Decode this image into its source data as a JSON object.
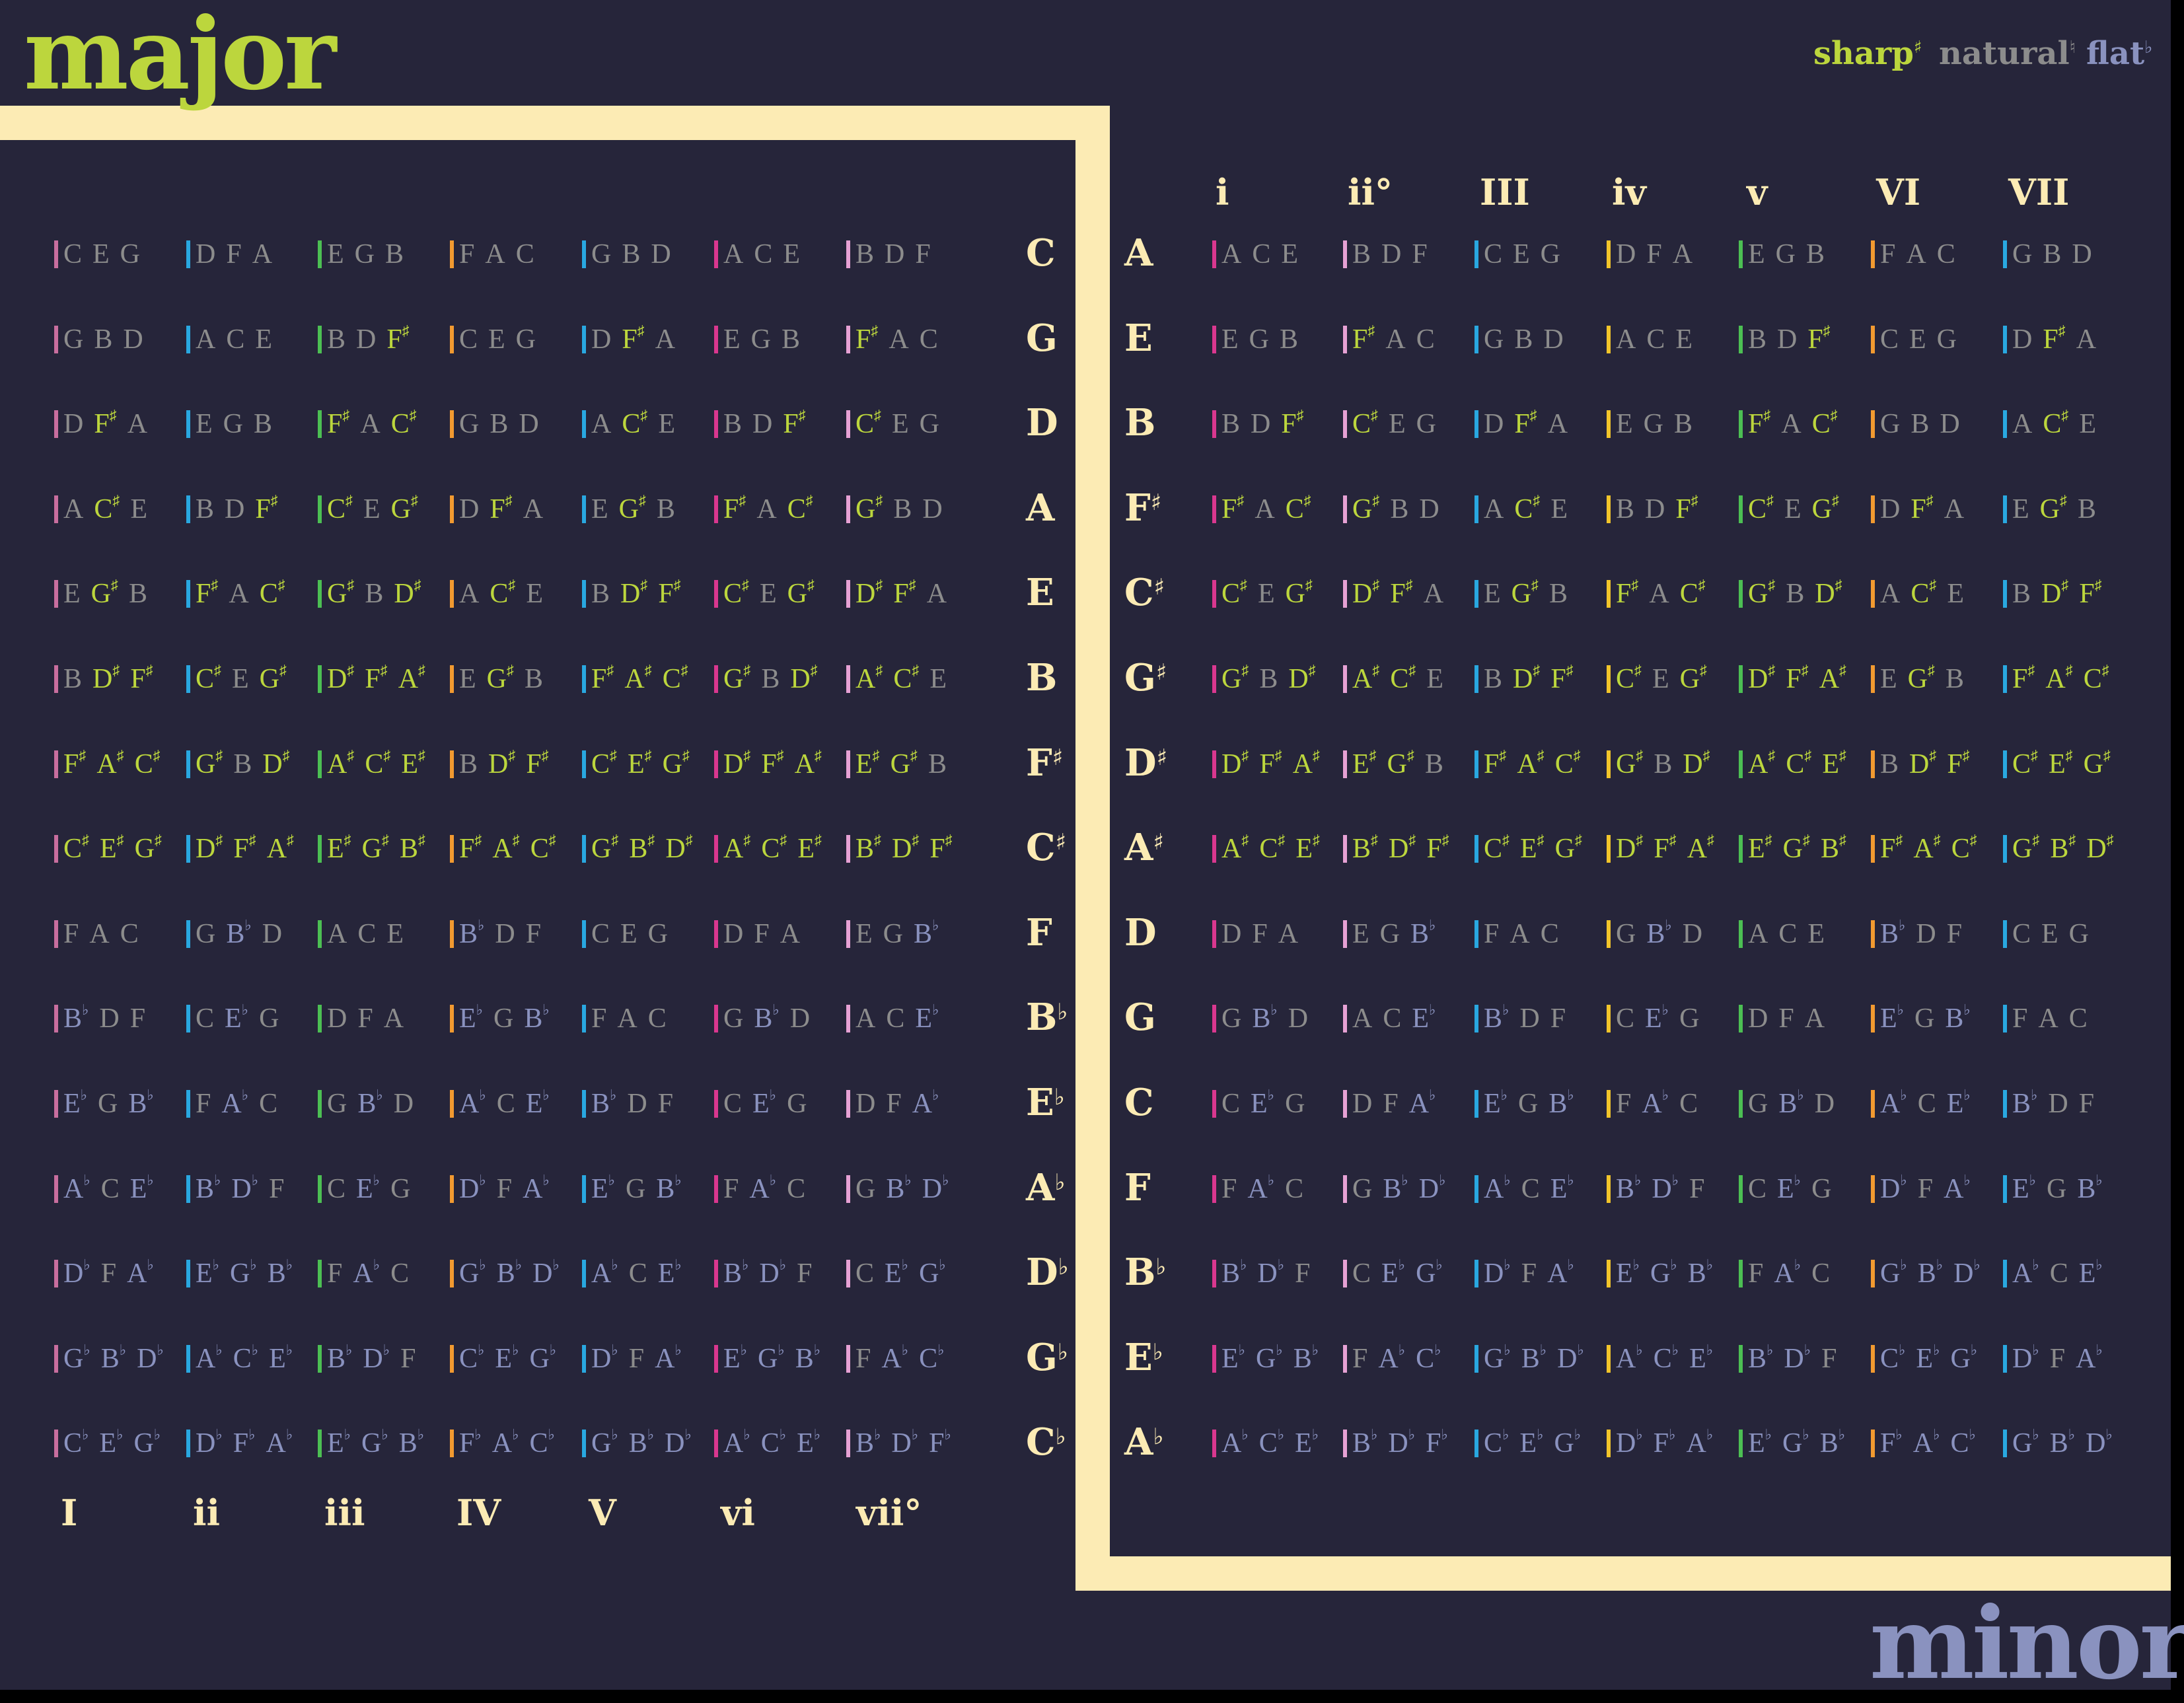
{
  "colors": {
    "background": "#26253a",
    "frame": "#fcebb4",
    "major_title": "#bcd63d",
    "minor_title": "#8a92bf",
    "sharp": "#bcd63d",
    "natural": "#8c8c8c",
    "flat": "#8a92bf",
    "key_label": "#fcebb4",
    "numeral": "#fcebb4"
  },
  "accidental_glyphs": {
    "#": "♯",
    "b": "♭",
    "n": "♮"
  },
  "titles": {
    "major": "major",
    "minor": "minor"
  },
  "legend": [
    {
      "label": "sharp",
      "symbol": "♯",
      "color": "#bcd63d"
    },
    {
      "label": "natural",
      "symbol": "♮",
      "color": "#8c8c8c"
    },
    {
      "label": "flat",
      "symbol": "♭",
      "color": "#8a92bf"
    }
  ],
  "numeral_bar_colors": {
    "I": "#c86e9e",
    "ii": "#29a8e0",
    "iii": "#4cbf53",
    "IV": "#f29a30",
    "V": "#29a8e0",
    "vi": "#d9378f",
    "vii°": "#e6a1d4",
    "i": "#d9378f",
    "ii°": "#e6a1d4",
    "III": "#29a8e0",
    "iv": "#f2c52a",
    "v": "#4cbf53",
    "VI": "#f29a30",
    "VII": "#29a8e0"
  },
  "major": {
    "numerals": [
      "I",
      "ii",
      "iii",
      "IV",
      "V",
      "vi",
      "vii°"
    ],
    "keys": [
      "C",
      "G",
      "D",
      "A",
      "E",
      "B",
      "F#",
      "C#",
      "F",
      "Bb",
      "Eb",
      "Ab",
      "Db",
      "Gb",
      "Cb"
    ],
    "rows": [
      [
        [
          "C",
          "E",
          "G"
        ],
        [
          "D",
          "F",
          "A"
        ],
        [
          "E",
          "G",
          "B"
        ],
        [
          "F",
          "A",
          "C"
        ],
        [
          "G",
          "B",
          "D"
        ],
        [
          "A",
          "C",
          "E"
        ],
        [
          "B",
          "D",
          "F"
        ]
      ],
      [
        [
          "G",
          "B",
          "D"
        ],
        [
          "A",
          "C",
          "E"
        ],
        [
          "B",
          "D",
          "F#"
        ],
        [
          "C",
          "E",
          "G"
        ],
        [
          "D",
          "F#",
          "A"
        ],
        [
          "E",
          "G",
          "B"
        ],
        [
          "F#",
          "A",
          "C"
        ]
      ],
      [
        [
          "D",
          "F#",
          "A"
        ],
        [
          "E",
          "G",
          "B"
        ],
        [
          "F#",
          "A",
          "C#"
        ],
        [
          "G",
          "B",
          "D"
        ],
        [
          "A",
          "C#",
          "E"
        ],
        [
          "B",
          "D",
          "F#"
        ],
        [
          "C#",
          "E",
          "G"
        ]
      ],
      [
        [
          "A",
          "C#",
          "E"
        ],
        [
          "B",
          "D",
          "F#"
        ],
        [
          "C#",
          "E",
          "G#"
        ],
        [
          "D",
          "F#",
          "A"
        ],
        [
          "E",
          "G#",
          "B"
        ],
        [
          "F#",
          "A",
          "C#"
        ],
        [
          "G#",
          "B",
          "D"
        ]
      ],
      [
        [
          "E",
          "G#",
          "B"
        ],
        [
          "F#",
          "A",
          "C#"
        ],
        [
          "G#",
          "B",
          "D#"
        ],
        [
          "A",
          "C#",
          "E"
        ],
        [
          "B",
          "D#",
          "F#"
        ],
        [
          "C#",
          "E",
          "G#"
        ],
        [
          "D#",
          "F#",
          "A"
        ]
      ],
      [
        [
          "B",
          "D#",
          "F#"
        ],
        [
          "C#",
          "E",
          "G#"
        ],
        [
          "D#",
          "F#",
          "A#"
        ],
        [
          "E",
          "G#",
          "B"
        ],
        [
          "F#",
          "A#",
          "C#"
        ],
        [
          "G#",
          "B",
          "D#"
        ],
        [
          "A#",
          "C#",
          "E"
        ]
      ],
      [
        [
          "F#",
          "A#",
          "C#"
        ],
        [
          "G#",
          "B",
          "D#"
        ],
        [
          "A#",
          "C#",
          "E#"
        ],
        [
          "B",
          "D#",
          "F#"
        ],
        [
          "C#",
          "E#",
          "G#"
        ],
        [
          "D#",
          "F#",
          "A#"
        ],
        [
          "E#",
          "G#",
          "B"
        ]
      ],
      [
        [
          "C#",
          "E#",
          "G#"
        ],
        [
          "D#",
          "F#",
          "A#"
        ],
        [
          "E#",
          "G#",
          "B#"
        ],
        [
          "F#",
          "A#",
          "C#"
        ],
        [
          "G#",
          "B#",
          "D#"
        ],
        [
          "A#",
          "C#",
          "E#"
        ],
        [
          "B#",
          "D#",
          "F#"
        ]
      ],
      [
        [
          "F",
          "A",
          "C"
        ],
        [
          "G",
          "Bb",
          "D"
        ],
        [
          "A",
          "C",
          "E"
        ],
        [
          "Bb",
          "D",
          "F"
        ],
        [
          "C",
          "E",
          "G"
        ],
        [
          "D",
          "F",
          "A"
        ],
        [
          "E",
          "G",
          "Bb"
        ]
      ],
      [
        [
          "Bb",
          "D",
          "F"
        ],
        [
          "C",
          "Eb",
          "G"
        ],
        [
          "D",
          "F",
          "A"
        ],
        [
          "Eb",
          "G",
          "Bb"
        ],
        [
          "F",
          "A",
          "C"
        ],
        [
          "G",
          "Bb",
          "D"
        ],
        [
          "A",
          "C",
          "Eb"
        ]
      ],
      [
        [
          "Eb",
          "G",
          "Bb"
        ],
        [
          "F",
          "Ab",
          "C"
        ],
        [
          "G",
          "Bb",
          "D"
        ],
        [
          "Ab",
          "C",
          "Eb"
        ],
        [
          "Bb",
          "D",
          "F"
        ],
        [
          "C",
          "Eb",
          "G"
        ],
        [
          "D",
          "F",
          "Ab"
        ]
      ],
      [
        [
          "Ab",
          "C",
          "Eb"
        ],
        [
          "Bb",
          "Db",
          "F"
        ],
        [
          "C",
          "Eb",
          "G"
        ],
        [
          "Db",
          "F",
          "Ab"
        ],
        [
          "Eb",
          "G",
          "Bb"
        ],
        [
          "F",
          "Ab",
          "C"
        ],
        [
          "G",
          "Bb",
          "Db"
        ]
      ],
      [
        [
          "Db",
          "F",
          "Ab"
        ],
        [
          "Eb",
          "Gb",
          "Bb"
        ],
        [
          "F",
          "Ab",
          "C"
        ],
        [
          "Gb",
          "Bb",
          "Db"
        ],
        [
          "Ab",
          "C",
          "Eb"
        ],
        [
          "Bb",
          "Db",
          "F"
        ],
        [
          "C",
          "Eb",
          "Gb"
        ]
      ],
      [
        [
          "Gb",
          "Bb",
          "Db"
        ],
        [
          "Ab",
          "Cb",
          "Eb"
        ],
        [
          "Bb",
          "Db",
          "F"
        ],
        [
          "Cb",
          "Eb",
          "Gb"
        ],
        [
          "Db",
          "F",
          "Ab"
        ],
        [
          "Eb",
          "Gb",
          "Bb"
        ],
        [
          "F",
          "Ab",
          "Cb"
        ]
      ],
      [
        [
          "Cb",
          "Eb",
          "Gb"
        ],
        [
          "Db",
          "Fb",
          "Ab"
        ],
        [
          "Eb",
          "Gb",
          "Bb"
        ],
        [
          "Fb",
          "Ab",
          "Cb"
        ],
        [
          "Gb",
          "Bb",
          "Db"
        ],
        [
          "Ab",
          "Cb",
          "Eb"
        ],
        [
          "Bb",
          "Db",
          "Fb"
        ]
      ]
    ]
  },
  "minor": {
    "numerals": [
      "i",
      "ii°",
      "III",
      "iv",
      "v",
      "VI",
      "VII"
    ],
    "keys": [
      "A",
      "E",
      "B",
      "F#",
      "C#",
      "G#",
      "D#",
      "A#",
      "D",
      "G",
      "C",
      "F",
      "Bb",
      "Eb",
      "Ab"
    ],
    "rows": [
      [
        [
          "A",
          "C",
          "E"
        ],
        [
          "B",
          "D",
          "F"
        ],
        [
          "C",
          "E",
          "G"
        ],
        [
          "D",
          "F",
          "A"
        ],
        [
          "E",
          "G",
          "B"
        ],
        [
          "F",
          "A",
          "C"
        ],
        [
          "G",
          "B",
          "D"
        ]
      ],
      [
        [
          "E",
          "G",
          "B"
        ],
        [
          "F#",
          "A",
          "C"
        ],
        [
          "G",
          "B",
          "D"
        ],
        [
          "A",
          "C",
          "E"
        ],
        [
          "B",
          "D",
          "F#"
        ],
        [
          "C",
          "E",
          "G"
        ],
        [
          "D",
          "F#",
          "A"
        ]
      ],
      [
        [
          "B",
          "D",
          "F#"
        ],
        [
          "C#",
          "E",
          "G"
        ],
        [
          "D",
          "F#",
          "A"
        ],
        [
          "E",
          "G",
          "B"
        ],
        [
          "F#",
          "A",
          "C#"
        ],
        [
          "G",
          "B",
          "D"
        ],
        [
          "A",
          "C#",
          "E"
        ]
      ],
      [
        [
          "F#",
          "A",
          "C#"
        ],
        [
          "G#",
          "B",
          "D"
        ],
        [
          "A",
          "C#",
          "E"
        ],
        [
          "B",
          "D",
          "F#"
        ],
        [
          "C#",
          "E",
          "G#"
        ],
        [
          "D",
          "F#",
          "A"
        ],
        [
          "E",
          "G#",
          "B"
        ]
      ],
      [
        [
          "C#",
          "E",
          "G#"
        ],
        [
          "D#",
          "F#",
          "A"
        ],
        [
          "E",
          "G#",
          "B"
        ],
        [
          "F#",
          "A",
          "C#"
        ],
        [
          "G#",
          "B",
          "D#"
        ],
        [
          "A",
          "C#",
          "E"
        ],
        [
          "B",
          "D#",
          "F#"
        ]
      ],
      [
        [
          "G#",
          "B",
          "D#"
        ],
        [
          "A#",
          "C#",
          "E"
        ],
        [
          "B",
          "D#",
          "F#"
        ],
        [
          "C#",
          "E",
          "G#"
        ],
        [
          "D#",
          "F#",
          "A#"
        ],
        [
          "E",
          "G#",
          "B"
        ],
        [
          "F#",
          "A#",
          "C#"
        ]
      ],
      [
        [
          "D#",
          "F#",
          "A#"
        ],
        [
          "E#",
          "G#",
          "B"
        ],
        [
          "F#",
          "A#",
          "C#"
        ],
        [
          "G#",
          "B",
          "D#"
        ],
        [
          "A#",
          "C#",
          "E#"
        ],
        [
          "B",
          "D#",
          "F#"
        ],
        [
          "C#",
          "E#",
          "G#"
        ]
      ],
      [
        [
          "A#",
          "C#",
          "E#"
        ],
        [
          "B#",
          "D#",
          "F#"
        ],
        [
          "C#",
          "E#",
          "G#"
        ],
        [
          "D#",
          "F#",
          "A#"
        ],
        [
          "E#",
          "G#",
          "B#"
        ],
        [
          "F#",
          "A#",
          "C#"
        ],
        [
          "G#",
          "B#",
          "D#"
        ]
      ],
      [
        [
          "D",
          "F",
          "A"
        ],
        [
          "E",
          "G",
          "Bb"
        ],
        [
          "F",
          "A",
          "C"
        ],
        [
          "G",
          "Bb",
          "D"
        ],
        [
          "A",
          "C",
          "E"
        ],
        [
          "Bb",
          "D",
          "F"
        ],
        [
          "C",
          "E",
          "G"
        ]
      ],
      [
        [
          "G",
          "Bb",
          "D"
        ],
        [
          "A",
          "C",
          "Eb"
        ],
        [
          "Bb",
          "D",
          "F"
        ],
        [
          "C",
          "Eb",
          "G"
        ],
        [
          "D",
          "F",
          "A"
        ],
        [
          "Eb",
          "G",
          "Bb"
        ],
        [
          "F",
          "A",
          "C"
        ]
      ],
      [
        [
          "C",
          "Eb",
          "G"
        ],
        [
          "D",
          "F",
          "Ab"
        ],
        [
          "Eb",
          "G",
          "Bb"
        ],
        [
          "F",
          "Ab",
          "C"
        ],
        [
          "G",
          "Bb",
          "D"
        ],
        [
          "Ab",
          "C",
          "Eb"
        ],
        [
          "Bb",
          "D",
          "F"
        ]
      ],
      [
        [
          "F",
          "Ab",
          "C"
        ],
        [
          "G",
          "Bb",
          "Db"
        ],
        [
          "Ab",
          "C",
          "Eb"
        ],
        [
          "Bb",
          "Db",
          "F"
        ],
        [
          "C",
          "Eb",
          "G"
        ],
        [
          "Db",
          "F",
          "Ab"
        ],
        [
          "Eb",
          "G",
          "Bb"
        ]
      ],
      [
        [
          "Bb",
          "Db",
          "F"
        ],
        [
          "C",
          "Eb",
          "Gb"
        ],
        [
          "Db",
          "F",
          "Ab"
        ],
        [
          "Eb",
          "Gb",
          "Bb"
        ],
        [
          "F",
          "Ab",
          "C"
        ],
        [
          "Gb",
          "Bb",
          "Db"
        ],
        [
          "Ab",
          "C",
          "Eb"
        ]
      ],
      [
        [
          "Eb",
          "Gb",
          "Bb"
        ],
        [
          "F",
          "Ab",
          "Cb"
        ],
        [
          "Gb",
          "Bb",
          "Db"
        ],
        [
          "Ab",
          "Cb",
          "Eb"
        ],
        [
          "Bb",
          "Db",
          "F"
        ],
        [
          "Cb",
          "Eb",
          "Gb"
        ],
        [
          "Db",
          "F",
          "Ab"
        ]
      ],
      [
        [
          "Ab",
          "Cb",
          "Eb"
        ],
        [
          "Bb",
          "Db",
          "Fb"
        ],
        [
          "Cb",
          "Eb",
          "Gb"
        ],
        [
          "Db",
          "Fb",
          "Ab"
        ],
        [
          "Eb",
          "Gb",
          "Bb"
        ],
        [
          "Fb",
          "Ab",
          "Cb"
        ],
        [
          "Gb",
          "Bb",
          "Db"
        ]
      ]
    ]
  }
}
